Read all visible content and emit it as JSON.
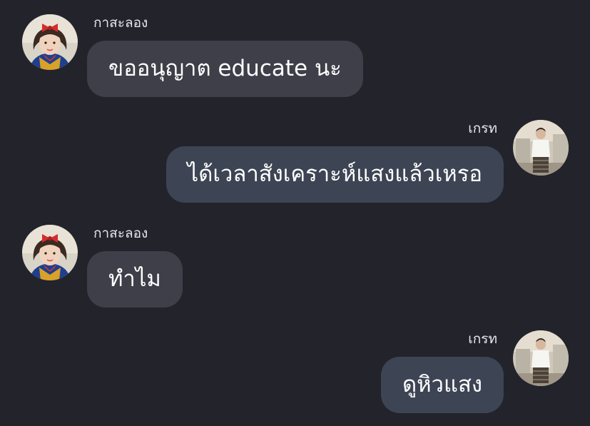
{
  "theme": {
    "background": "#23232b",
    "incoming_bubble": "#3f3f49",
    "outgoing_bubble": "#3d4454",
    "text": "#ffffff"
  },
  "messages": [
    {
      "sender": "กาสะลอง",
      "direction": "incoming",
      "text": "ขออนุญาต educate นะ",
      "avatar": "avatar-girl-bow"
    },
    {
      "sender": "เกรท",
      "direction": "outgoing",
      "text": "ได้เวลาสังเคราะห์แสงแล้วเหรอ",
      "avatar": "avatar-boy"
    },
    {
      "sender": "กาสะลอง",
      "direction": "incoming",
      "text": "ทำไม",
      "avatar": "avatar-girl-bow"
    },
    {
      "sender": "เกรท",
      "direction": "outgoing",
      "text": "ดูหิวแสง",
      "avatar": "avatar-boy"
    }
  ]
}
